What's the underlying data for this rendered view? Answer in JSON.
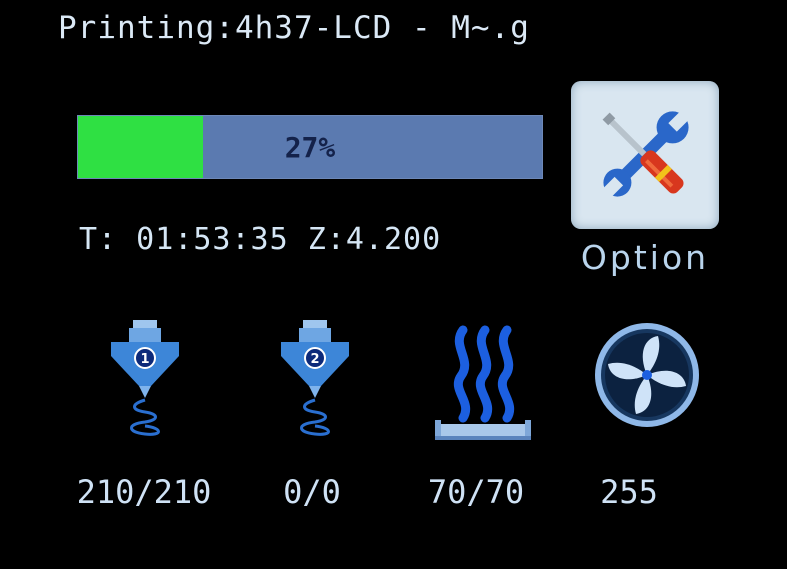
{
  "header": {
    "title": "Printing:4h37-LCD - M~.g"
  },
  "progress": {
    "percent": 27,
    "label": "27%"
  },
  "status": {
    "line": "T: 01:53:35 Z:4.200"
  },
  "option": {
    "label": "Option",
    "icon": "wrench-screwdriver-icon"
  },
  "sensors": [
    {
      "icon": "extruder-1-icon",
      "badge": "1",
      "value": "210/210"
    },
    {
      "icon": "extruder-2-icon",
      "badge": "2",
      "value": "0/0"
    },
    {
      "icon": "heated-bed-icon",
      "value": "70/70"
    },
    {
      "icon": "fan-icon",
      "value": "255"
    }
  ],
  "colors": {
    "background": "#000000",
    "progress_fill": "#2fe043",
    "progress_track": "#5b7ab0",
    "text": "#cfe4f7"
  }
}
